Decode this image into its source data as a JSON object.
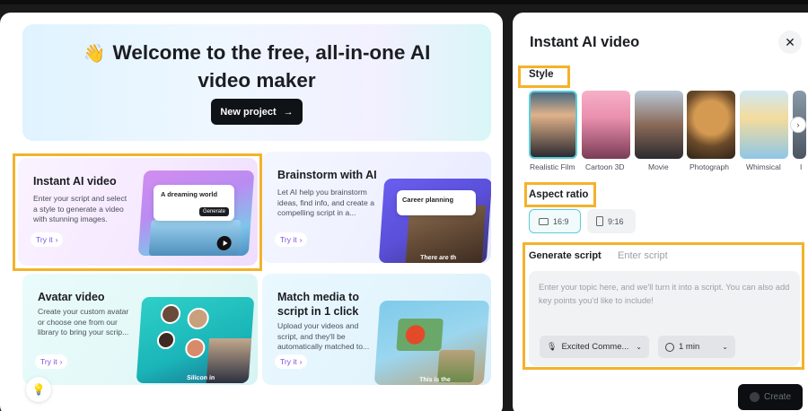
{
  "hero": {
    "emoji": "👋",
    "title_line1": "Welcome to the free, all-in-one AI",
    "title_line2": "video maker",
    "new_project_label": "New project"
  },
  "cards": [
    {
      "title": "Instant AI video",
      "desc": "Enter your script and select a style to generate a video with stunning images.",
      "try": "Try it",
      "chip": "A dreaming world",
      "chip_btn": "Generate"
    },
    {
      "title": "Brainstorm with AI",
      "desc": "Let AI help you brainstorm ideas, find info, and create a compelling script in a...",
      "try": "Try it",
      "chip": "Career planning",
      "overlay": "There are th"
    },
    {
      "title": "Avatar video",
      "desc": "Create your custom avatar or choose one from our library to bring your scrip...",
      "try": "Try it",
      "overlay": "Silicon in"
    },
    {
      "title_line1": "Match media to",
      "title_line2": "script in 1 click",
      "desc": "Upload your videos and script, and they'll be automatically matched to...",
      "try": "Try it",
      "overlay": "This is the"
    }
  ],
  "panel": {
    "title": "Instant AI video",
    "style_label": "Style",
    "styles": [
      "Realistic Film",
      "Cartoon 3D",
      "Movie",
      "Photograph",
      "Whimsical",
      "I"
    ],
    "aspect_label": "Aspect ratio",
    "aspect_options": [
      "16:9",
      "9:16"
    ],
    "tab_generate": "Generate script",
    "tab_enter": "Enter script",
    "placeholder": "Enter your topic here, and we'll turn it into a script. You can also add key points you'd like to include!",
    "tone": "Excited Comme...",
    "duration": "1 min",
    "create_label": "Create"
  },
  "colors": {
    "highlight": "#f4b22a",
    "accent": "#7b4fe0",
    "selected": "#5ccbd8"
  }
}
